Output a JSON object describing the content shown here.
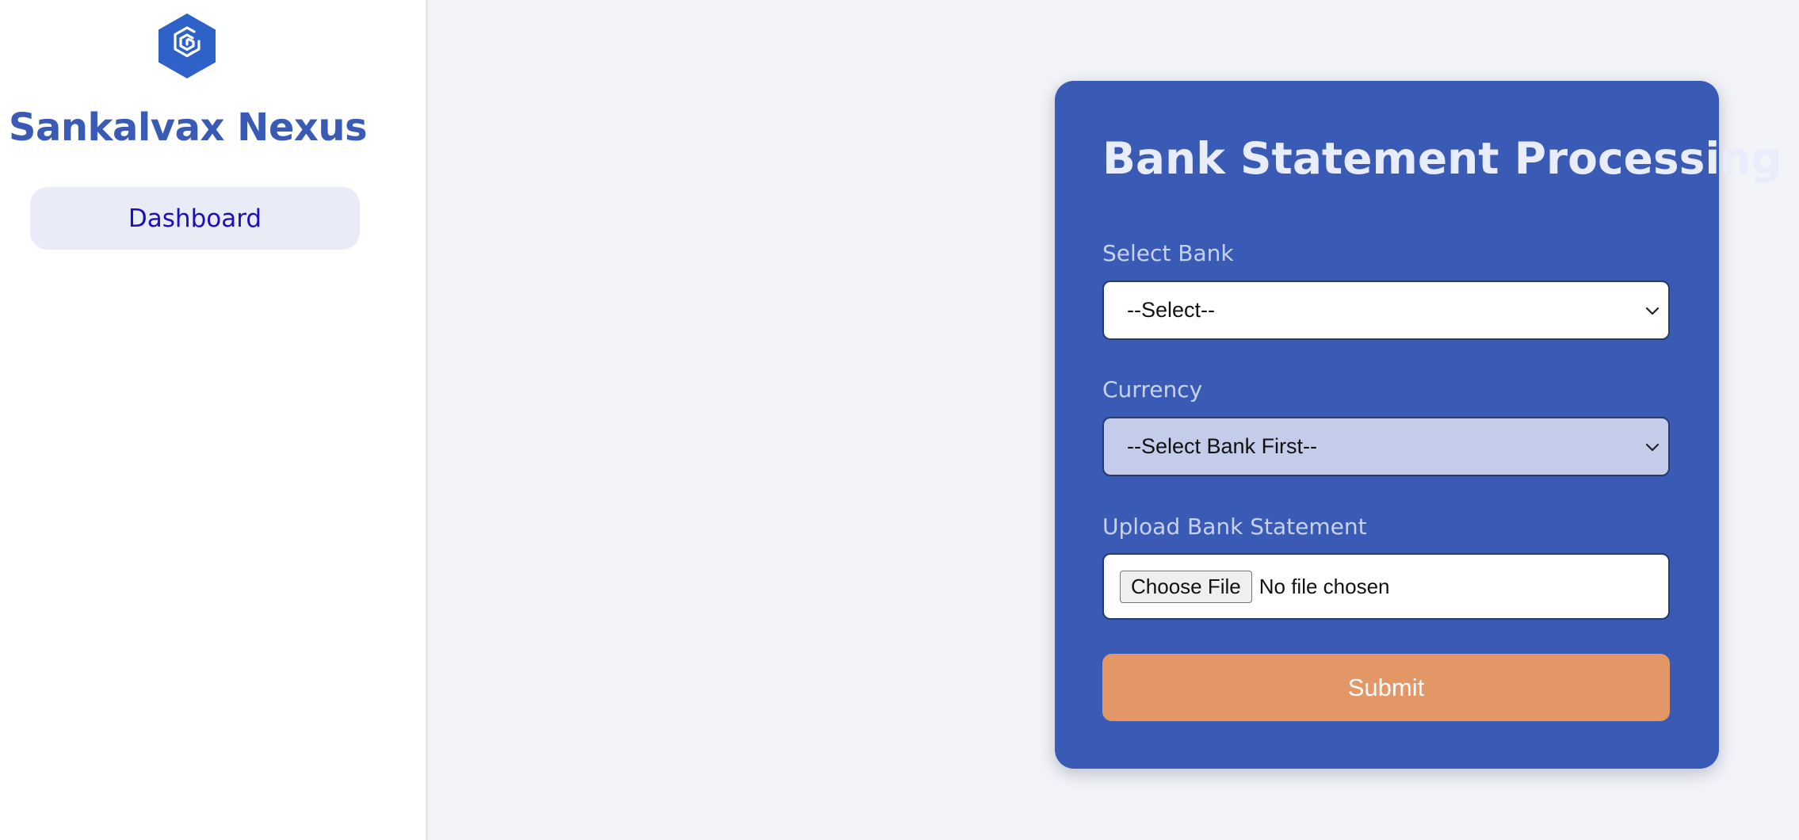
{
  "app": {
    "brand_name": "Sankalvax Nexus",
    "logo_icon": "hexagon-logo-icon",
    "brand_color": "#3a5bb5"
  },
  "sidebar": {
    "items": [
      {
        "label": "Dashboard"
      }
    ]
  },
  "form": {
    "title": "Bank Statement Processing",
    "bank": {
      "label": "Select Bank",
      "selected": "--Select--"
    },
    "currency": {
      "label": "Currency",
      "selected": "--Select Bank First--",
      "disabled": true
    },
    "upload": {
      "label": "Upload Bank Statement",
      "button_label": "Choose File",
      "status": "No file chosen"
    },
    "submit_label": "Submit",
    "submit_color": "#e39666"
  }
}
